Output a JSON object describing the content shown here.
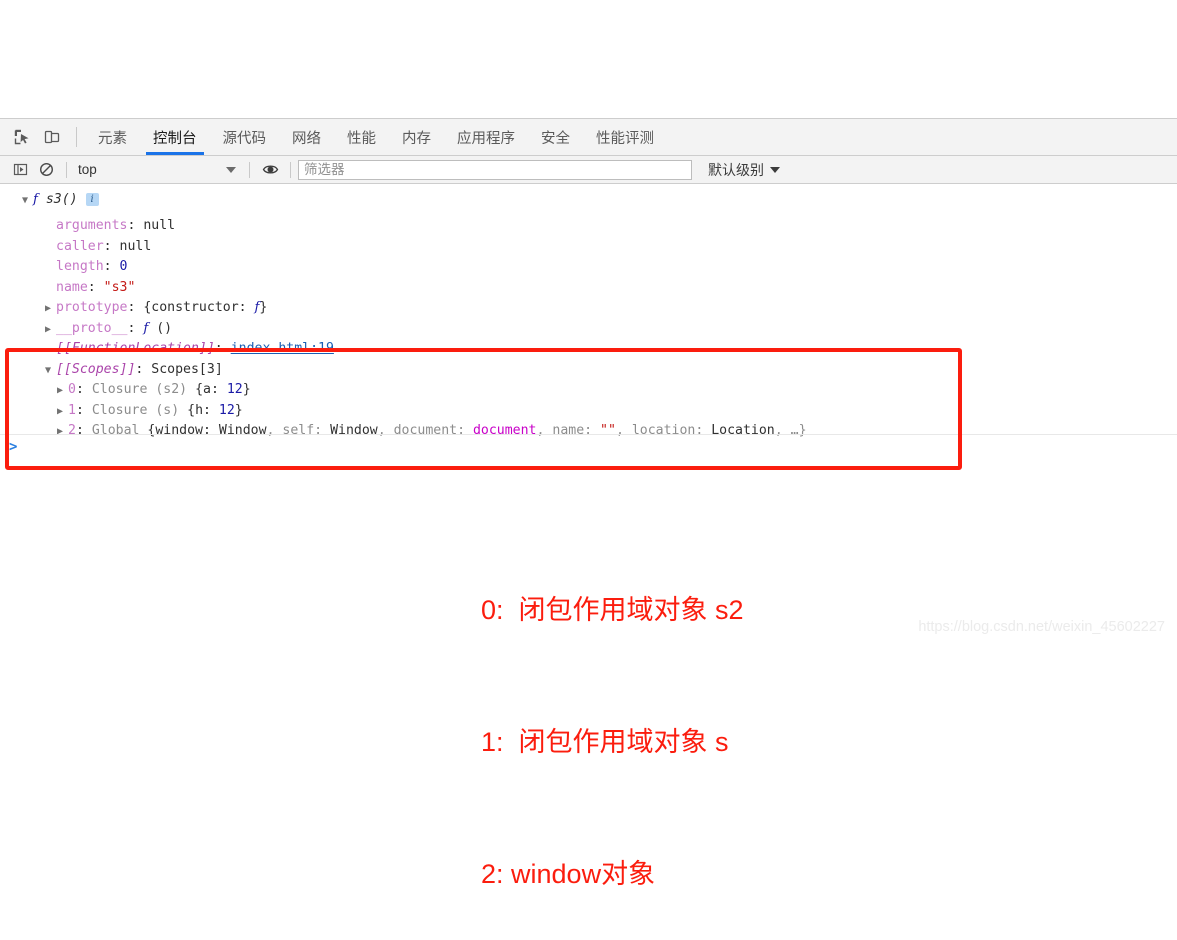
{
  "devtools": {
    "toolbar_icons": [
      {
        "name": "inspect-element-icon",
        "label": "Inspect element"
      },
      {
        "name": "device-toolbar-icon",
        "label": "Toggle device toolbar"
      }
    ],
    "tabs": [
      {
        "id": "elements",
        "label": "元素",
        "active": false
      },
      {
        "id": "console",
        "label": "控制台",
        "active": true
      },
      {
        "id": "sources",
        "label": "源代码",
        "active": false
      },
      {
        "id": "network",
        "label": "网络",
        "active": false
      },
      {
        "id": "performance",
        "label": "性能",
        "active": false
      },
      {
        "id": "memory",
        "label": "内存",
        "active": false
      },
      {
        "id": "application",
        "label": "应用程序",
        "active": false
      },
      {
        "id": "security",
        "label": "安全",
        "active": false
      },
      {
        "id": "lighthouse",
        "label": "性能评测",
        "active": false
      }
    ]
  },
  "console_toolbar": {
    "sidebar_toggle_icon": "console-sidebar-icon",
    "clear_icon": "clear-console-icon",
    "context": "top",
    "eye_icon": "live-expression-icon",
    "filter_placeholder": "筛选器",
    "filter_value": "",
    "level_label": "默认级别"
  },
  "console_output": {
    "header": {
      "func_keyword": "f",
      "func_signature": "s3()",
      "info_badge": "i"
    },
    "rows": [
      {
        "prop": "arguments",
        "sep": ": ",
        "value": "null",
        "value_kind": "null"
      },
      {
        "prop": "caller",
        "sep": ": ",
        "value": "null",
        "value_kind": "null"
      },
      {
        "prop": "length",
        "sep": ": ",
        "value": "0",
        "value_kind": "num"
      },
      {
        "prop": "name",
        "sep": ": ",
        "value": "\"s3\"",
        "value_kind": "str"
      }
    ],
    "prototype_row": {
      "prop": "prototype",
      "sep": ": ",
      "value_open": "{constructor: ",
      "value_f": "f",
      "value_close": "}"
    },
    "proto_row": {
      "prop": "__proto__",
      "sep": ": ",
      "value_f": "f",
      "value_rest": " ()"
    },
    "function_location_row": {
      "prop": "[[FunctionLocation]]",
      "sep": ": ",
      "link": "index.html:19"
    },
    "scopes_row": {
      "prop": "[[Scopes]]",
      "sep": ": ",
      "value": "Scopes[3]"
    },
    "scope_items": [
      {
        "index": "0",
        "sep": ": ",
        "kind": "Closure (s2) ",
        "body_open": "{a: ",
        "body_num": "12",
        "body_close": "}"
      },
      {
        "index": "1",
        "sep": ": ",
        "kind": "Closure (s) ",
        "body_open": "{h: ",
        "body_num": "12",
        "body_close": "}"
      },
      {
        "index": "2",
        "sep": ": ",
        "kind": "Global ",
        "body_open": "{window: ",
        "body_close": "}"
      }
    ],
    "global_detail": {
      "window_val": "Window",
      "self_key": ", self: ",
      "self_val": "Window",
      "document_key": ", document: ",
      "document_val": "document",
      "name_key": ", name: ",
      "name_val": "\"\"",
      "location_key": ", location: ",
      "location_val": "Location",
      "ellipsis": ", …}"
    },
    "prompt_caret": ">"
  },
  "annotations": {
    "lines": [
      "0:  闭包作用域对象 s2",
      "1:  闭包作用域对象 s",
      "2: window对象"
    ],
    "color": "#fb1d0e"
  },
  "watermark": {
    "text": "https://blog.csdn.net/weixin_45602227"
  }
}
